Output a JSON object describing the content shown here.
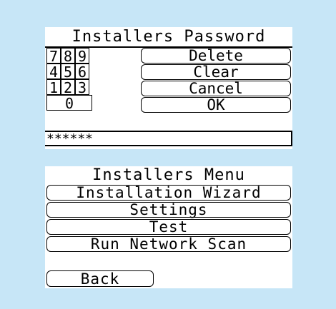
{
  "password_screen": {
    "title": "Installers Password",
    "keypad": {
      "row1": [
        "7",
        "8",
        "9"
      ],
      "row2": [
        "4",
        "5",
        "6"
      ],
      "row3": [
        "1",
        "2",
        "3"
      ],
      "zero": "0"
    },
    "buttons": {
      "delete": "Delete",
      "clear": "Clear",
      "cancel": "Cancel",
      "ok": "OK"
    },
    "entry_value": "******"
  },
  "menu_screen": {
    "title": "Installers Menu",
    "items": [
      "Installation Wizard",
      "Settings",
      "Test",
      "Run Network Scan"
    ],
    "back": "Back"
  },
  "colors": {
    "background": "#c7e6f7",
    "screen": "#ffffff",
    "foreground": "#000000"
  }
}
